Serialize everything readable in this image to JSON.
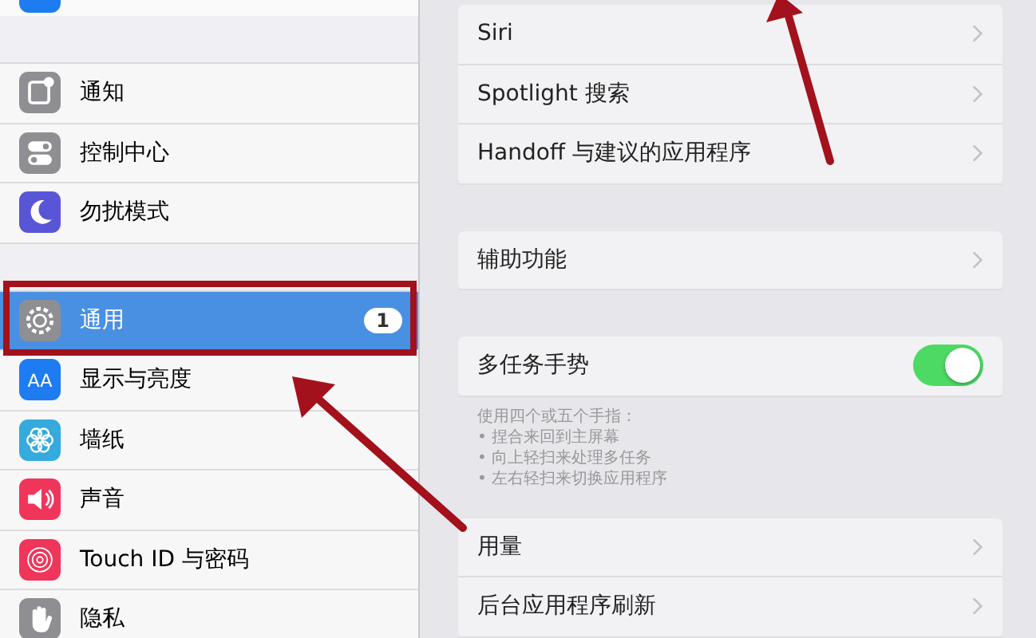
{
  "sidebar": {
    "groups": [
      {
        "items": [
          {
            "label": "通知",
            "kind": "notify",
            "color": "#8e8e93",
            "selected": false
          },
          {
            "label": "控制中心",
            "kind": "switches",
            "color": "#8e8e93",
            "selected": false
          },
          {
            "label": "勿扰模式",
            "kind": "moon",
            "color": "#5856d6",
            "selected": false
          }
        ]
      },
      {
        "items": [
          {
            "label": "通用",
            "kind": "gear",
            "color": "#8e8e93",
            "selected": true,
            "badge": "1"
          },
          {
            "label": "显示与亮度",
            "kind": "text",
            "icon_text": "AA",
            "color": "#1e7cf2",
            "selected": false
          },
          {
            "label": "墙纸",
            "kind": "flower",
            "color": "#35aadc",
            "selected": false
          },
          {
            "label": "声音",
            "kind": "speaker",
            "color": "#f0355b",
            "selected": false
          },
          {
            "label": "Touch ID 与密码",
            "kind": "fingerprint",
            "color": "#f0355b",
            "selected": false
          },
          {
            "label": "隐私",
            "kind": "hand",
            "color": "#8e8e93",
            "selected": false
          }
        ]
      }
    ]
  },
  "settings": {
    "groups": [
      {
        "rows": [
          {
            "kind": "link",
            "label": "Siri"
          },
          {
            "kind": "link",
            "label": "Spotlight 搜索"
          },
          {
            "kind": "link",
            "label": "Handoff 与建议的应用程序"
          }
        ]
      },
      {
        "rows": [
          {
            "kind": "link",
            "label": "辅助功能"
          }
        ]
      },
      {
        "rows": [
          {
            "kind": "toggle",
            "label": "多任务手势",
            "on": true
          }
        ],
        "footer": [
          "使用四个或五个手指：",
          "• 捏合来回到主屏幕",
          "• 向上轻扫来处理多任务",
          "• 左右轻扫来切换应用程序"
        ]
      },
      {
        "rows": [
          {
            "kind": "link",
            "label": "用量"
          },
          {
            "kind": "link",
            "label": "后台应用程序刷新"
          }
        ]
      }
    ]
  }
}
